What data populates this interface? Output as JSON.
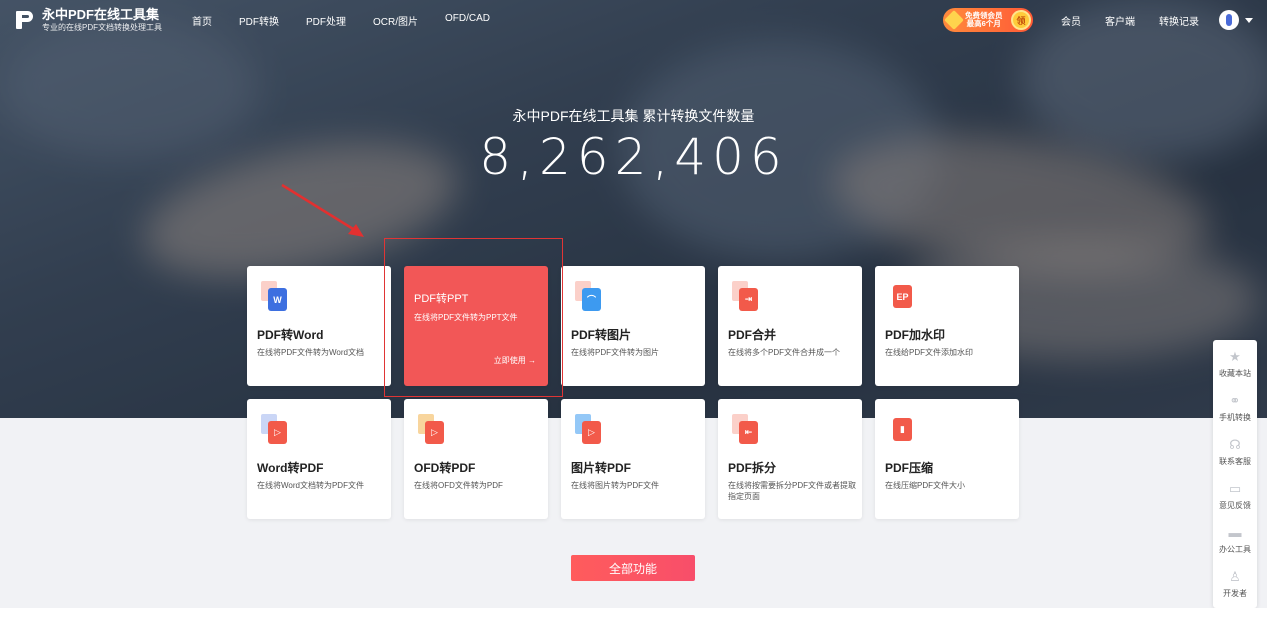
{
  "brand": {
    "name": "永中PDF在线工具集",
    "tagline": "专业的在线PDF文档转换处理工具"
  },
  "nav": [
    "首页",
    "PDF转换",
    "PDF处理",
    "OCR/图片",
    "OFD/CAD"
  ],
  "promo": {
    "line1": "免费领会员",
    "line2": "最高6个月",
    "badge": "领"
  },
  "nav_right": [
    "会员",
    "客户端",
    "转换记录"
  ],
  "counter": {
    "title": "永中PDF在线工具集  累计转换文件数量",
    "value": "8,262,406"
  },
  "tools": [
    {
      "title": "PDF转Word",
      "desc": "在线将PDF文件转为Word文档",
      "glyph": "W"
    },
    {
      "title": "PDF转PPT",
      "desc": "在线将PDF文件转为PPT文件",
      "action": "立即使用 →"
    },
    {
      "title": "PDF转图片",
      "desc": "在线将PDF文件转为图片",
      "glyph": "⌒"
    },
    {
      "title": "PDF合并",
      "desc": "在线将多个PDF文件合并成一个",
      "glyph": "⇥"
    },
    {
      "title": "PDF加水印",
      "desc": "在线给PDF文件添加水印",
      "glyph": "EP"
    },
    {
      "title": "Word转PDF",
      "desc": "在线将Word文档转为PDF文件",
      "glyph": "▷"
    },
    {
      "title": "OFD转PDF",
      "desc": "在线将OFD文件转为PDF",
      "glyph": "▷"
    },
    {
      "title": "图片转PDF",
      "desc": "在线将图片转为PDF文件",
      "glyph": "▷"
    },
    {
      "title": "PDF拆分",
      "desc": "在线将按需要拆分PDF文件或者提取指定页面",
      "glyph": "⇤"
    },
    {
      "title": "PDF压缩",
      "desc": "在线压缩PDF文件大小",
      "glyph": "▮"
    }
  ],
  "all_features": "全部功能",
  "sidebar": [
    "收藏本站",
    "手机转换",
    "联系客服",
    "意见反馈",
    "办公工具",
    "开发者"
  ],
  "colors": {
    "accent": "#f25757",
    "button": "#f84e6a",
    "highlight_border": "#e03535"
  }
}
